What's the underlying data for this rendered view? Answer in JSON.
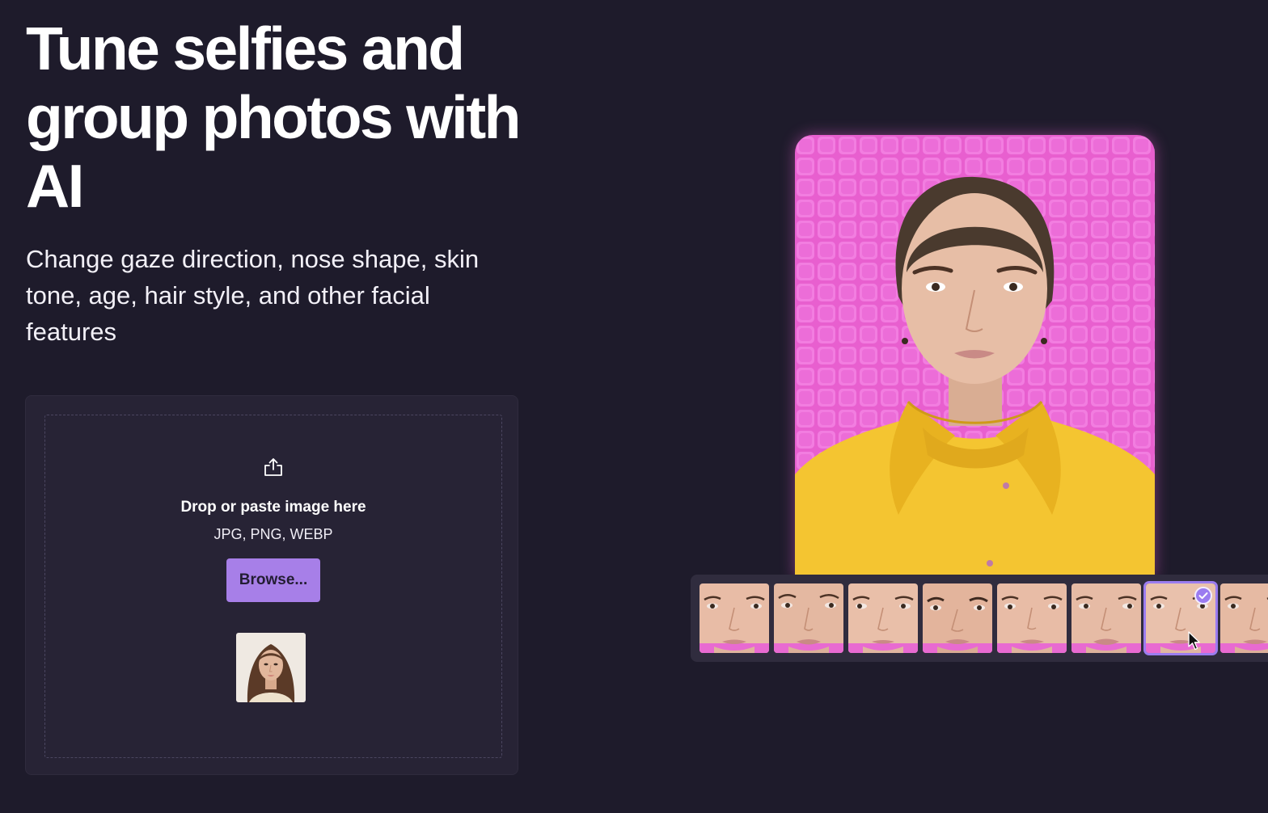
{
  "hero": {
    "title": "Tune selfies and group photos with AI",
    "subtitle": "Change gaze direction, nose shape, skin tone, age, hair style, and other facial features"
  },
  "upload": {
    "icon": "upload-icon",
    "drop_label": "Drop or paste image here",
    "formats": "JPG, PNG, WEBP",
    "browse_label": "Browse..."
  },
  "variations": {
    "count_visible": 8,
    "selected_index": 6
  },
  "colors": {
    "background": "#1e1b2b",
    "card": "#272335",
    "accent": "#a77fe8",
    "preview_backdrop": "#ec62d1",
    "jacket": "#f4c531"
  }
}
